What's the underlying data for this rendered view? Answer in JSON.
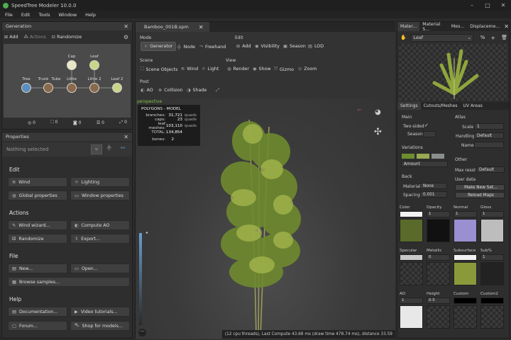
{
  "app": {
    "title": "SpeedTree  Modeler 10.0.0"
  },
  "menu": [
    "File",
    "Edit",
    "Tools",
    "Window",
    "Help"
  ],
  "generation": {
    "title": "Generation",
    "add": "Add",
    "actions": "Actions",
    "randomize": "Randomize",
    "nodes": [
      {
        "label": "Tree"
      },
      {
        "label": "Trunk"
      },
      {
        "label": "Tube"
      },
      {
        "label": "Little"
      },
      {
        "label": "Cap"
      },
      {
        "label": "Leaf"
      },
      {
        "label": "Little 2"
      },
      {
        "label": "Leaf 2"
      }
    ],
    "counts": [
      "0",
      "0",
      "0",
      "0",
      "0"
    ]
  },
  "properties": {
    "title": "Properties",
    "nothing": "Nothing selected",
    "edit_h": "Edit",
    "wind": "Wind",
    "lighting": "Lighting",
    "global": "Global properties",
    "window": "Window properties",
    "actions_h": "Actions",
    "wind_wizard": "Wind wizard...",
    "compute_ao": "Compute AO",
    "randomize": "Randomize",
    "export": "Export...",
    "file_h": "File",
    "new": "New...",
    "open": "Open...",
    "browse": "Browse samples...",
    "help_h": "Help",
    "docs": "Documentation...",
    "video": "Video tutorials...",
    "forum": "Forum...",
    "shop": "Shop for models..."
  },
  "viewport": {
    "tab": "Bamboo_001B.spm",
    "mode_h": "Mode",
    "generator": "Generator",
    "node": "Node",
    "freehand": "Freehand",
    "edit_h": "Edit",
    "add": "Add",
    "visibility": "Visibility",
    "season": "Season",
    "lod": "LOD",
    "scene_h": "Scene",
    "scene_objects": "Scene Objects",
    "wind": "Wind",
    "light": "Light",
    "view_h": "View",
    "render": "Render",
    "show": "Show",
    "gizmo": "Gizmo",
    "zoom": "Zoom",
    "post_h": "Post",
    "ao": "AO",
    "collision": "Collision",
    "shade": "Shade",
    "perspective": "perspective",
    "stats": {
      "title": "POLYGONS - MODEL",
      "rows": [
        [
          "branches:",
          "31,721",
          "quads"
        ],
        [
          "caps:",
          "23",
          "quads"
        ],
        [
          "leaf meshes:",
          "103,110",
          "quads"
        ],
        [
          "TOTAL:",
          "134,854",
          ""
        ]
      ],
      "bones_label": "bones:",
      "bones": "2"
    },
    "status": "(12 cpu threads), Last Compute 43.68 ms (draw time 478.74 ms), distance 33.59"
  },
  "materials": {
    "tabs": [
      "Mater...",
      "Material S...",
      "Mes...",
      "Displaceme..."
    ],
    "selected": "Leaf",
    "subtabs": [
      "Settings",
      "Cutouts/Meshes",
      "UV Areas"
    ],
    "main_h": "Main",
    "two_sided": "Two-sided",
    "season": "Season",
    "atlas_h": "Atlas",
    "scale": "Scale",
    "scale_v": "1",
    "handling": "Handling",
    "handling_v": "Default",
    "name": "Name",
    "variations_h": "Variations",
    "amount": "Amount",
    "back_h": "Back",
    "material": "Material",
    "material_v": "None",
    "spacing": "Spacing",
    "spacing_v": "0.001",
    "other_h": "Other",
    "max_res": "Max resol",
    "max_res_v": "Default",
    "user_data": "User data",
    "make_new": "Make New Set...",
    "reload": "Reload Maps",
    "textures": [
      {
        "label": "Color",
        "val": ""
      },
      {
        "label": "Opacity",
        "val": "1"
      },
      {
        "label": "Normal",
        "val": "1"
      },
      {
        "label": "Gloss",
        "val": "1"
      },
      {
        "label": "Specular",
        "val": ""
      },
      {
        "label": "Metallic",
        "val": "0"
      },
      {
        "label": "Subsurface",
        "val": ""
      },
      {
        "label": "Sub%",
        "val": "1"
      },
      {
        "label": "AO",
        "val": "1"
      },
      {
        "label": "Height",
        "val": "0.5"
      },
      {
        "label": "Custom",
        "val": ""
      },
      {
        "label": "Custom2",
        "val": ""
      }
    ]
  },
  "colors": {
    "accent": "#4a8fd0",
    "leaf": "#8fa63c",
    "variation1": "#6e8f2e",
    "variation2": "#9aaa52",
    "variation3": "#8a8f8e"
  }
}
